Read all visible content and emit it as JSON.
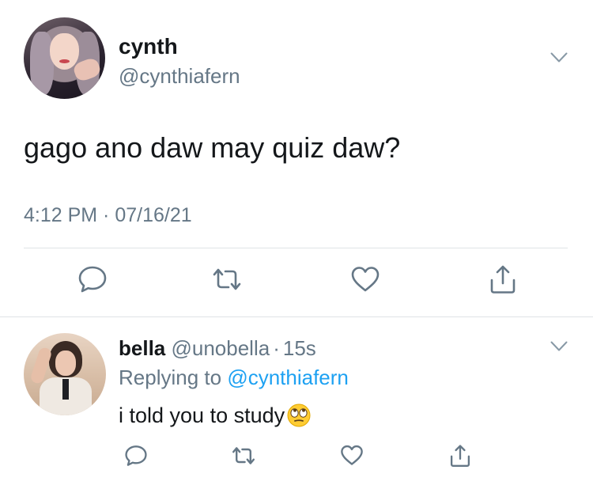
{
  "main_tweet": {
    "author": {
      "name": "cynth",
      "handle": "@cynthiafern"
    },
    "text": "gago ano daw may quiz daw?",
    "timestamp": "4:12 PM · 07/16/21",
    "actions": [
      "reply-icon",
      "retweet-icon",
      "like-icon",
      "share-icon"
    ]
  },
  "reply_tweet": {
    "author": {
      "name": "bella",
      "handle": "@unobella"
    },
    "separator": "·",
    "age": "15s",
    "replying_prefix": "Replying to",
    "replying_to": "@cynthiafern",
    "text": "i told you to study",
    "emoji": "face-with-rolling-eyes",
    "actions": [
      "reply-icon",
      "retweet-icon",
      "like-icon",
      "share-icon"
    ]
  },
  "colors": {
    "text": "#14171a",
    "muted": "#657786",
    "link": "#1da1f2",
    "divider": "#dfe3e6"
  }
}
